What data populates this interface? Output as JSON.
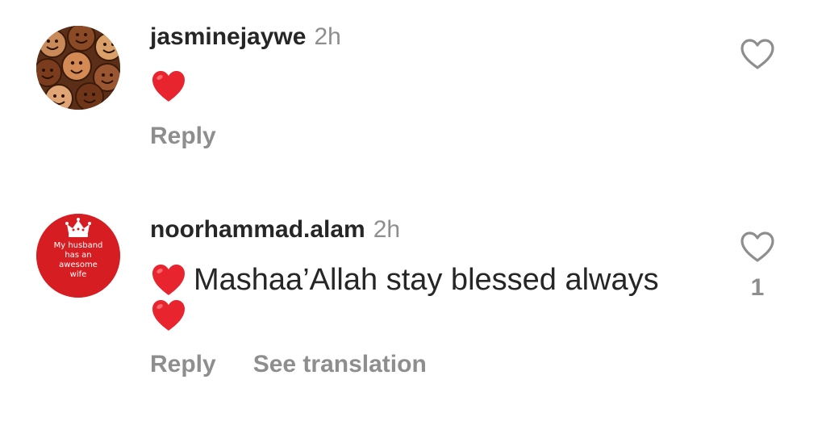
{
  "comments": [
    {
      "username": "jasminejaywe",
      "timestamp": "2h",
      "avatar_icon": "smiley-pattern-avatar",
      "text": "",
      "emoji": [
        "red-heart-icon"
      ],
      "reply_label": "Reply",
      "like_count": ""
    },
    {
      "username": "noorhammad.alam",
      "timestamp": "2h",
      "avatar_icon": "crown-badge-avatar",
      "avatar_text": [
        "My husband",
        "has an",
        "awesome",
        "wife"
      ],
      "text": "Mashaa’Allah stay blessed always",
      "emoji": [
        "red-heart-icon",
        "red-heart-icon"
      ],
      "reply_label": "Reply",
      "translate_label": "See translation",
      "like_count": "1"
    }
  ],
  "colors": {
    "username": "#262626",
    "muted": "#8e8e8e",
    "heart": "#e8242f",
    "avatar_red": "#d61d22"
  }
}
